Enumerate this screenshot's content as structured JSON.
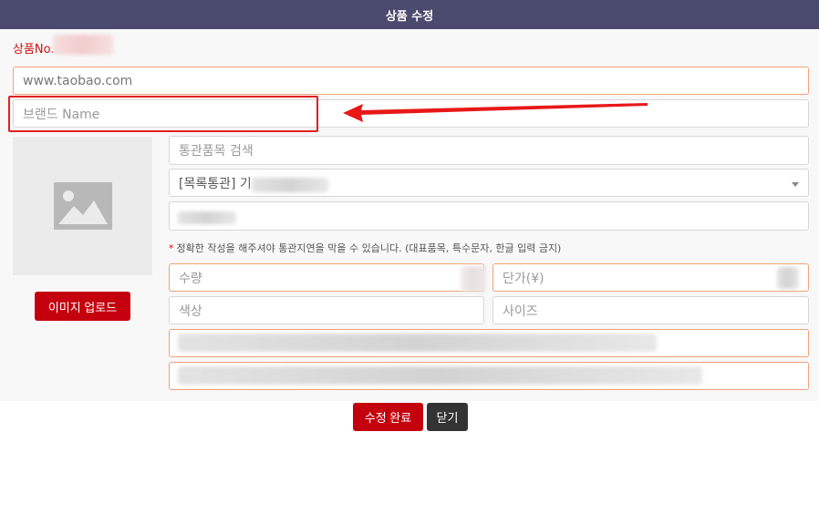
{
  "window": {
    "title": "상품 수정"
  },
  "product": {
    "number_label": "상품No."
  },
  "fields": {
    "url": {
      "value": "www.taobao.com"
    },
    "brand": {
      "placeholder": "브랜드 Name"
    },
    "customs_search": {
      "placeholder": "통관품목 검색"
    },
    "customs_select": {
      "value": "[목록통관] 기"
    },
    "quantity": {
      "placeholder": "수량"
    },
    "unit_price": {
      "placeholder": "단가(¥)"
    },
    "color": {
      "placeholder": "색상"
    },
    "size": {
      "placeholder": "사이즈"
    }
  },
  "hint": {
    "star": "*",
    "text": "정확한 작성을 해주셔야 통관지연을 막을 수 있습니다. (대표품목, 특수문자, 한글 입력 금지)"
  },
  "buttons": {
    "upload": "이미지 업로드",
    "save": "수정 완료",
    "close": "닫기"
  },
  "icons": {
    "image": "image-placeholder-icon",
    "dropdown": "chevron-down-icon",
    "annotation": "arrow-left-icon"
  },
  "colors": {
    "titlebar": "#4a4a6e",
    "accent_red": "#c4000e",
    "highlight": "#e02020",
    "field_border_orange": "#f0a276"
  }
}
